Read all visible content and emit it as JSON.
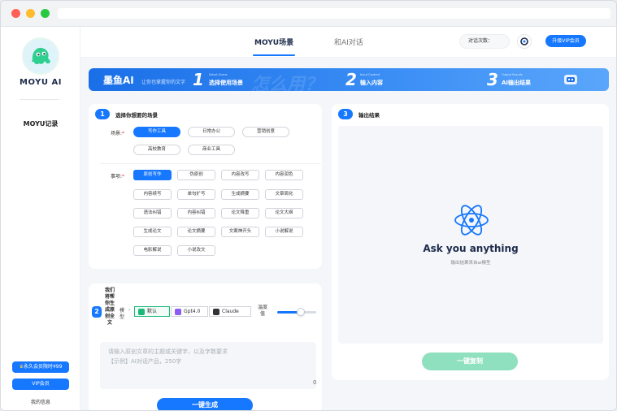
{
  "app": {
    "name": "MOYU AI"
  },
  "sidebar": {
    "history_link": "MOYU记录",
    "promo_label": "永久会员限时¥99",
    "vip_label": "VIP会员",
    "profile_label": "我的信息"
  },
  "topbar": {
    "tabs": [
      {
        "label": "MOYU场景",
        "active": true
      },
      {
        "label": "和AI对话",
        "active": false
      }
    ],
    "chat_count_label": "对话次数：",
    "upgrade_label": "升级VIP会员"
  },
  "banner": {
    "title": "墨鱼AI",
    "subtitle": "让你也掌握你的文字",
    "watermark": "怎么用？",
    "steps": [
      {
        "num": "1",
        "en": "Select Scene",
        "cn": "选择使用场景"
      },
      {
        "num": "2",
        "en": "Input Content",
        "cn": "输入内容"
      },
      {
        "num": "3",
        "en": "Output Results",
        "cn": "AI输出结果"
      }
    ]
  },
  "scene_card": {
    "step": "1",
    "title": "选择你想要的场景",
    "scene_label": "场景:",
    "scenes": [
      "写作工具",
      "日常办公",
      "营销创意",
      "高校教育",
      "商业工具"
    ],
    "selected_scene": "写作工具",
    "item_label": "事项:",
    "items": [
      "原创写作",
      "伪原创",
      "内容改写",
      "内容润色",
      "内容续写",
      "单句扩写",
      "生成摘要",
      "文章简化",
      "语法纠错",
      "内容纠错",
      "论文降重",
      "论文大纲",
      "生成论文",
      "论文摘要",
      "文案神开头",
      "小说解说",
      "电影解说",
      "小说改文"
    ],
    "selected_item": "原创写作"
  },
  "input_card": {
    "step": "2",
    "title": "我们将帮你生成原创全文",
    "model_label": "模型",
    "models": [
      {
        "label": "默认",
        "icon": "chatgpt-icon",
        "color": "#1ab97a",
        "selected": true
      },
      {
        "label": "Gpt4.0",
        "icon": "gpt4-icon",
        "color": "#8a5cf6",
        "selected": false
      },
      {
        "label": "Claude",
        "icon": "claude-icon",
        "color": "#333333",
        "selected": false
      }
    ],
    "temperature_label": "温度值",
    "temperature_value": 0.6,
    "placeholder_line1": "请输入原创文章的主题或关键字，以及字数要求",
    "placeholder_line2": "【示例】AI对话产品，250字",
    "char_count": "0",
    "generate_label": "一键生成"
  },
  "output_card": {
    "step": "3",
    "title": "输出结果",
    "headline": "Ask you anything",
    "subtext": "输出结果来自ai模型",
    "copy_label": "一键复制"
  },
  "colors": {
    "accent": "#1677ff",
    "copy_button": "#8fe0bf"
  }
}
